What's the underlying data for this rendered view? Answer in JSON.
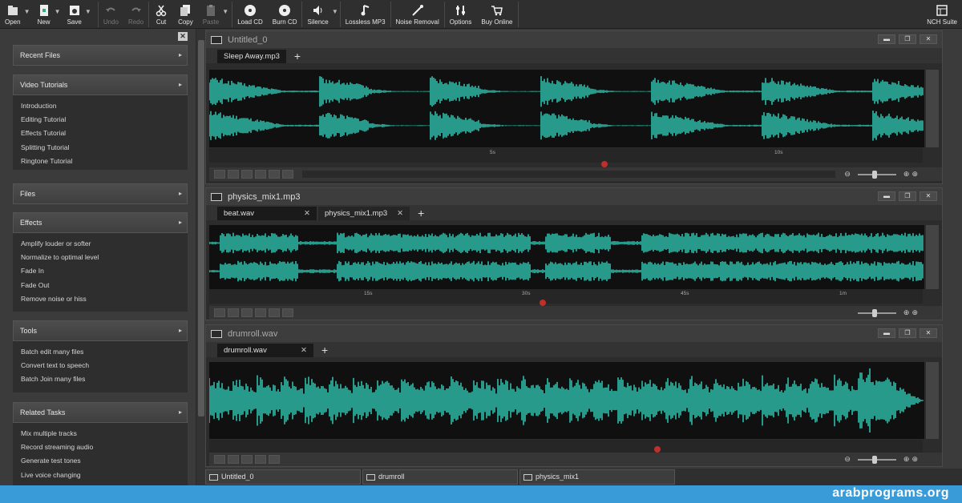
{
  "toolbar": {
    "buttons": [
      {
        "label": "Open",
        "icon": "open-icon",
        "enabled": true,
        "dropdown": true
      },
      {
        "label": "New",
        "icon": "new-file-icon",
        "enabled": true,
        "dropdown": true
      },
      {
        "label": "Save",
        "icon": "save-icon",
        "enabled": true,
        "dropdown": true
      },
      {
        "label": "Undo",
        "icon": "undo-icon",
        "enabled": false
      },
      {
        "label": "Redo",
        "icon": "redo-icon",
        "enabled": false
      },
      {
        "label": "Cut",
        "icon": "cut-icon",
        "enabled": true
      },
      {
        "label": "Copy",
        "icon": "copy-icon",
        "enabled": true
      },
      {
        "label": "Paste",
        "icon": "paste-icon",
        "enabled": false,
        "dropdown": true
      },
      {
        "label": "Load CD",
        "icon": "load-cd-icon",
        "enabled": true
      },
      {
        "label": "Burn CD",
        "icon": "burn-cd-icon",
        "enabled": true
      },
      {
        "label": "Silence",
        "icon": "silence-icon",
        "enabled": true,
        "dropdown": true
      },
      {
        "label": "Lossless MP3",
        "icon": "lossless-mp3-icon",
        "enabled": true
      },
      {
        "label": "Noise Removal",
        "icon": "noise-removal-icon",
        "enabled": true
      },
      {
        "label": "Options",
        "icon": "options-icon",
        "enabled": true
      },
      {
        "label": "Buy Online",
        "icon": "cart-icon",
        "enabled": true
      },
      {
        "label": "NCH Suite",
        "icon": "nch-suite-icon",
        "enabled": true
      }
    ]
  },
  "sidebar": {
    "sections": [
      {
        "title": "Recent Files",
        "items": []
      },
      {
        "title": "Video Tutorials",
        "items": [
          "Introduction",
          "Editing Tutorial",
          "Effects Tutorial",
          "Splitting Tutorial",
          "Ringtone Tutorial"
        ]
      },
      {
        "title": "Files",
        "items": []
      },
      {
        "title": "Effects",
        "items": [
          "Amplify louder or softer",
          "Normalize to optimal level",
          "Fade In",
          "Fade Out",
          "Remove noise or hiss"
        ]
      },
      {
        "title": "Tools",
        "items": [
          "Batch edit many files",
          "Convert text to speech",
          "Batch Join many files"
        ]
      },
      {
        "title": "Related Tasks",
        "items": [
          "Mix multiple tracks",
          "Record streaming audio",
          "Generate test tones",
          "Live voice changing"
        ]
      }
    ]
  },
  "panes": [
    {
      "title": "Untitled_0",
      "tabs": [
        {
          "label": "Sleep Away.mp3",
          "active": true,
          "closable": false
        }
      ],
      "ruler": [
        "5s",
        "10s"
      ]
    },
    {
      "title": "physics_mix1.mp3",
      "tabs": [
        {
          "label": "beat.wav",
          "active": true,
          "closable": true
        },
        {
          "label": "physics_mix1.mp3",
          "active": false,
          "closable": true
        }
      ],
      "ruler": [
        "15s",
        "30s",
        "45s",
        "1m"
      ]
    },
    {
      "title": "drumroll.wav",
      "tabs": [
        {
          "label": "drumroll.wav",
          "active": true,
          "closable": true
        }
      ],
      "ruler": []
    }
  ],
  "taskbar": [
    "Untitled_0",
    "drumroll",
    "physics_mix1"
  ],
  "colors": {
    "waveform": "#33d6c0",
    "marker": "#c0302a",
    "background": "#2c2c2c"
  },
  "watermark": "arabprograms.org"
}
